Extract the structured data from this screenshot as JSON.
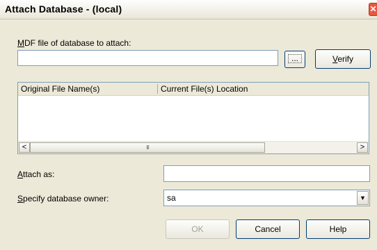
{
  "window": {
    "title": "Attach Database - (local)",
    "close_glyph": "✕"
  },
  "mdf": {
    "label_prefix": "",
    "label_mnemonic": "M",
    "label_rest": "DF file of database to attach:",
    "value": ""
  },
  "browse_button": {
    "label": "..."
  },
  "verify_button": {
    "label_mnemonic": "V",
    "label_rest": "erify"
  },
  "file_list": {
    "columns": [
      "Original File Name(s)",
      "Current File(s) Location"
    ],
    "rows": [],
    "scroll_left": "<",
    "scroll_right": ">",
    "thumb_grip": "III"
  },
  "attach_as": {
    "label_mnemonic": "A",
    "label_rest": "ttach as:",
    "value": ""
  },
  "owner": {
    "label_mnemonic": "S",
    "label_rest": "pecify database owner:",
    "value": "sa",
    "dropdown_glyph": "▼"
  },
  "buttons": {
    "ok": "OK",
    "cancel": "Cancel",
    "help": "Help"
  }
}
